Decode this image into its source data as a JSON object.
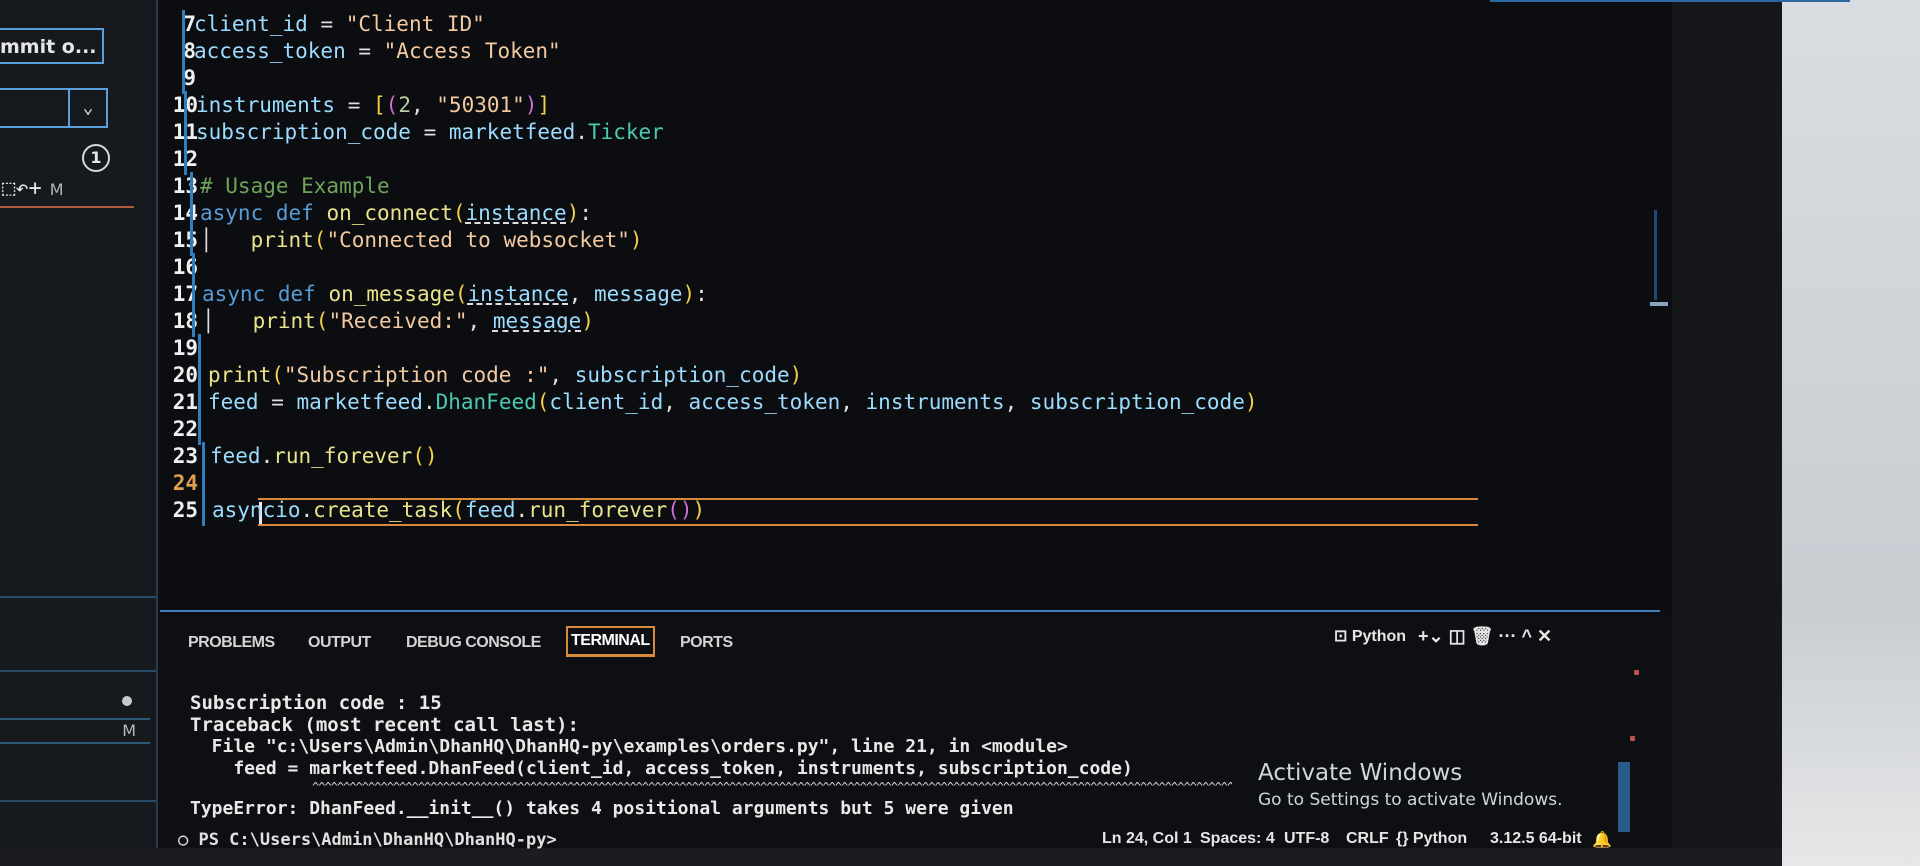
{
  "sidebar": {
    "commit_label": "mmit o...",
    "chevron": "⌄",
    "badge": "1",
    "actions": "⬚↶+",
    "modified_flag": "M",
    "file_modified_flag": "M"
  },
  "editor": {
    "lines": [
      {
        "n": "7",
        "parts": [
          [
            "var",
            "client_id"
          ],
          [
            "op",
            " = "
          ],
          [
            "str",
            "\"Client ID\""
          ]
        ]
      },
      {
        "n": "8",
        "parts": [
          [
            "var",
            "access_token"
          ],
          [
            "op",
            " = "
          ],
          [
            "str",
            "\"Access Token\""
          ]
        ]
      },
      {
        "n": "9",
        "parts": []
      },
      {
        "n": "10",
        "parts": [
          [
            "var",
            "instruments"
          ],
          [
            "op",
            " = "
          ],
          [
            "brk",
            "["
          ],
          [
            "brk2",
            "("
          ],
          [
            "num",
            "2"
          ],
          [
            "op",
            ", "
          ],
          [
            "str",
            "\"50301\""
          ],
          [
            "brk2",
            ")"
          ],
          [
            "brk",
            "]"
          ]
        ]
      },
      {
        "n": "11",
        "parts": [
          [
            "var",
            "subscription_code"
          ],
          [
            "op",
            " = "
          ],
          [
            "var",
            "marketfeed"
          ],
          [
            "op",
            "."
          ],
          [
            "cls",
            "Ticker"
          ]
        ]
      },
      {
        "n": "12",
        "parts": []
      },
      {
        "n": "13",
        "parts": [
          [
            "cmt",
            "# Usage Example"
          ]
        ]
      },
      {
        "n": "14",
        "parts": [
          [
            "kw",
            "async def "
          ],
          [
            "fn",
            "on_connect"
          ],
          [
            "brk",
            "("
          ],
          [
            "var",
            "instance"
          ],
          [
            "brk",
            ")"
          ],
          [
            "op",
            ":"
          ]
        ]
      },
      {
        "n": "15",
        "parts": [
          [
            "op",
            "│   "
          ],
          [
            "fn",
            "print"
          ],
          [
            "brk",
            "("
          ],
          [
            "str",
            "\"Connected to websocket\""
          ],
          [
            "brk",
            ")"
          ]
        ]
      },
      {
        "n": "16",
        "parts": []
      },
      {
        "n": "17",
        "parts": [
          [
            "kw",
            "async def "
          ],
          [
            "fn",
            "on_message"
          ],
          [
            "brk",
            "("
          ],
          [
            "var",
            "instance"
          ],
          [
            "op",
            ", "
          ],
          [
            "var",
            "message"
          ],
          [
            "brk",
            ")"
          ],
          [
            "op",
            ":"
          ]
        ]
      },
      {
        "n": "18",
        "parts": [
          [
            "op",
            "│   "
          ],
          [
            "fn",
            "print"
          ],
          [
            "brk",
            "("
          ],
          [
            "str",
            "\"Received:\""
          ],
          [
            "op",
            ", "
          ],
          [
            "var",
            "message"
          ],
          [
            "brk",
            ")"
          ]
        ]
      },
      {
        "n": "19",
        "parts": []
      },
      {
        "n": "20",
        "parts": [
          [
            "fn",
            "print"
          ],
          [
            "brk",
            "("
          ],
          [
            "str",
            "\"Subscription code :\""
          ],
          [
            "op",
            ", "
          ],
          [
            "var",
            "subscription_code"
          ],
          [
            "brk",
            ")"
          ]
        ]
      },
      {
        "n": "21",
        "parts": [
          [
            "var",
            "feed"
          ],
          [
            "op",
            " = "
          ],
          [
            "var",
            "marketfeed"
          ],
          [
            "op",
            "."
          ],
          [
            "cls",
            "DhanFeed"
          ],
          [
            "brk",
            "("
          ],
          [
            "var",
            "client_id"
          ],
          [
            "op",
            ", "
          ],
          [
            "var",
            "access_token"
          ],
          [
            "op",
            ", "
          ],
          [
            "var",
            "instruments"
          ],
          [
            "op",
            ", "
          ],
          [
            "var",
            "subscription_code"
          ],
          [
            "brk",
            ")"
          ]
        ]
      },
      {
        "n": "22",
        "parts": []
      },
      {
        "n": "23",
        "parts": [
          [
            "var",
            "feed"
          ],
          [
            "op",
            "."
          ],
          [
            "fn",
            "run_forever"
          ],
          [
            "brk",
            "()"
          ]
        ]
      },
      {
        "n": "24",
        "parts": []
      },
      {
        "n": "25",
        "parts": [
          [
            "var",
            "asyncio"
          ],
          [
            "op",
            "."
          ],
          [
            "fn",
            "create_task"
          ],
          [
            "brk",
            "("
          ],
          [
            "var",
            "feed"
          ],
          [
            "op",
            "."
          ],
          [
            "fn",
            "run_forever"
          ],
          [
            "brk2",
            "()"
          ],
          [
            "brk",
            ")"
          ]
        ]
      }
    ]
  },
  "panel": {
    "tabs": [
      "PROBLEMS",
      "OUTPUT",
      "DEBUG CONSOLE",
      "TERMINAL",
      "PORTS"
    ],
    "active_tab": "TERMINAL",
    "shell_label": "Python",
    "actions": "+⌄  ◫  🗑  ···  ^  ✕",
    "terminal_lines": [
      "Subscription code : 15",
      "Traceback (most recent call last):",
      "  File \"c:\\Users\\Admin\\DhanHQ\\DhanHQ-py\\examples\\orders.py\", line 21, in <module>",
      "    feed = marketfeed.DhanFeed(client_id, access_token, instruments, subscription_code)",
      "TypeError: DhanFeed.__init__() takes 4 positional arguments but 5 were given"
    ],
    "caret_marks": "^^^^^^^^^^^^^^^^^^^^^^^^^^^^^^^^^^^^^^^^^^^^^^^^^^^^^^^^^^^^^^^^^^^^^^^^^^^^^^^^^^^^^^^^^^^^^^^^^^^^^^^^^^^^^^^^^^^^^^^^^^^^^^^^^^^^^^^^^^^^^^^^^^^^^^^^^^",
    "prompt": "○ PS C:\\Users\\Admin\\DhanHQ\\DhanHQ-py>"
  },
  "activate_windows": {
    "title": "Activate Windows",
    "subtitle": "Go to Settings to activate Windows."
  },
  "status_bar": {
    "position": "Ln 24, Col 1",
    "spaces": "Spaces: 4",
    "encoding": "UTF-8",
    "eol": "CRLF",
    "language": "{} Python",
    "interpreter": "3.12.5 64-bit",
    "bell": "🔔"
  }
}
